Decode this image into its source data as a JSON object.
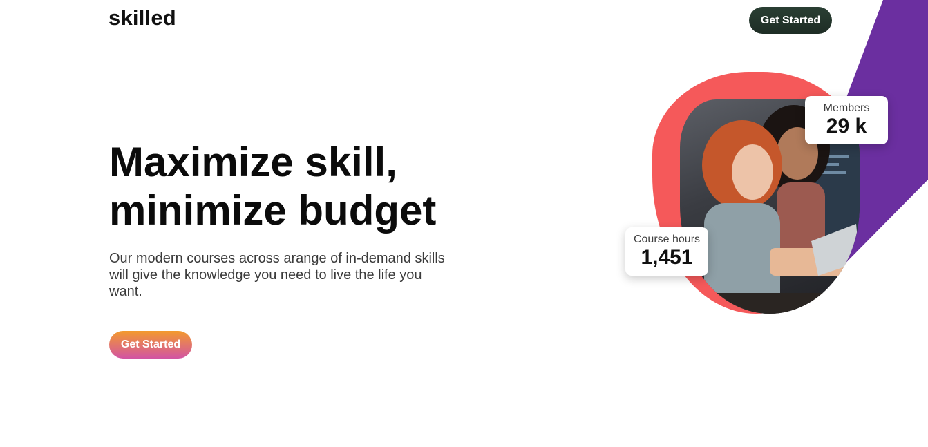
{
  "brand": {
    "logo_text": "skilled"
  },
  "nav": {
    "cta_label": "Get Started"
  },
  "hero": {
    "headline_line1": "Maximize skill,",
    "headline_line2": "minimize budget",
    "description": "Our modern courses across arange of in-demand skills will give the knowledge you need to live the life you want.",
    "cta_label": "Get Started"
  },
  "stats": {
    "members": {
      "label": "Members",
      "value": "29 k"
    },
    "course_hours": {
      "label": "Course hours",
      "value": "1,451"
    }
  },
  "colors": {
    "accent_purple": "#6b2fa0",
    "blob_coral": "#f5595a",
    "nav_button": "#263a2f",
    "cta_gradient_start": "#f39a2e",
    "cta_gradient_end": "#d254a3"
  },
  "icons": {
    "hero_image": "people-working-at-computer-photo"
  }
}
